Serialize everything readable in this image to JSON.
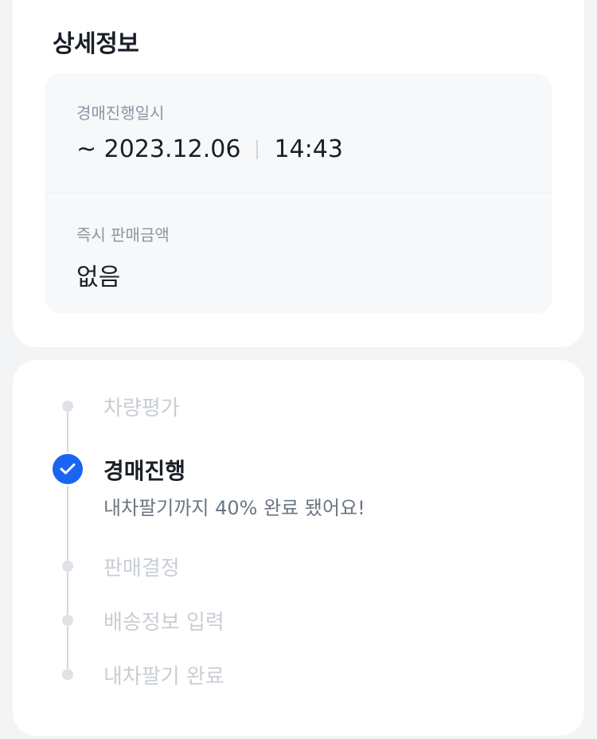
{
  "detail": {
    "title": "상세정보",
    "rows": [
      {
        "label": "경매진행일시",
        "date": "~ 2023.12.06",
        "time": "14:43"
      },
      {
        "label": "즉시 판매금액",
        "value": "없음"
      }
    ]
  },
  "progress": {
    "steps": [
      {
        "label": "차량평가",
        "state": "inactive"
      },
      {
        "label": "경매진행",
        "state": "active",
        "subtitle": "내차팔기까지 40% 완료 됐어요!"
      },
      {
        "label": "판매결정",
        "state": "inactive"
      },
      {
        "label": "배송정보 입력",
        "state": "inactive"
      },
      {
        "label": "내차팔기 완료",
        "state": "inactive"
      }
    ]
  },
  "colors": {
    "background": "#f2f4f6",
    "accent": "#1b64f2",
    "inactive_text": "#c9ced4",
    "inactive_dot": "#dfe2e6"
  }
}
